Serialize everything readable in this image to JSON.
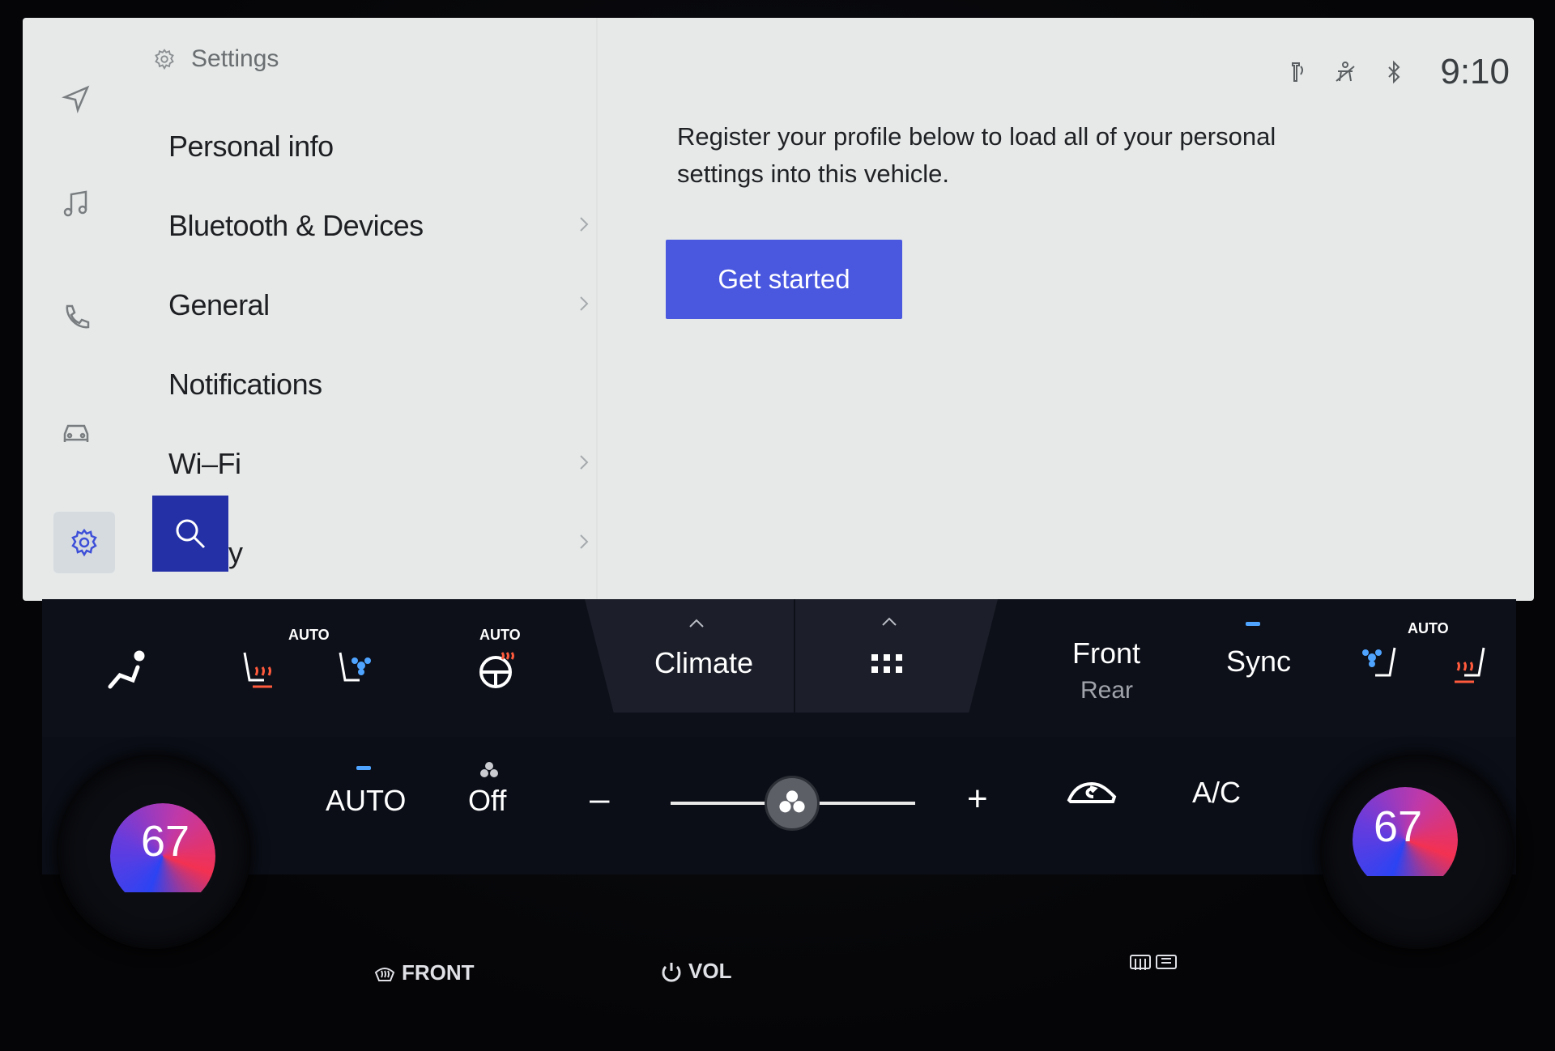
{
  "screen": {
    "settings_title": "Settings",
    "menu": [
      {
        "label": "Personal info",
        "chevron": false
      },
      {
        "label": "Bluetooth & Devices",
        "chevron": true
      },
      {
        "label": "General",
        "chevron": true
      },
      {
        "label": "Notifications",
        "chevron": false
      },
      {
        "label": "Wi–Fi",
        "chevron": true
      },
      {
        "label": "y",
        "chevron": true
      }
    ],
    "intro_text": "Register your profile below to load all of your personal settings into this vehicle.",
    "cta_label": "Get started",
    "status": {
      "time": "9:10",
      "icons": [
        "wireless-charging-icon",
        "seatbelt-off-icon",
        "bluetooth-icon"
      ]
    },
    "rail_icons": [
      "navigation-icon",
      "music-icon",
      "phone-icon",
      "car-icon",
      "settings-icon"
    ],
    "accent": "#4a58e0"
  },
  "climate": {
    "tab_climate": "Climate",
    "tab_apps_icon": "grid-icon",
    "front_label": "Front",
    "rear_label": "Rear",
    "sync_label": "Sync",
    "auto_tag": "AUTO",
    "auto_label": "AUTO",
    "fan_off_label": "Off",
    "minus": "–",
    "plus": "+",
    "ac_label": "A/C",
    "left_temp": "67",
    "right_temp": "67"
  },
  "hardware": {
    "front_defrost": "FRONT",
    "vol": "VOL"
  }
}
